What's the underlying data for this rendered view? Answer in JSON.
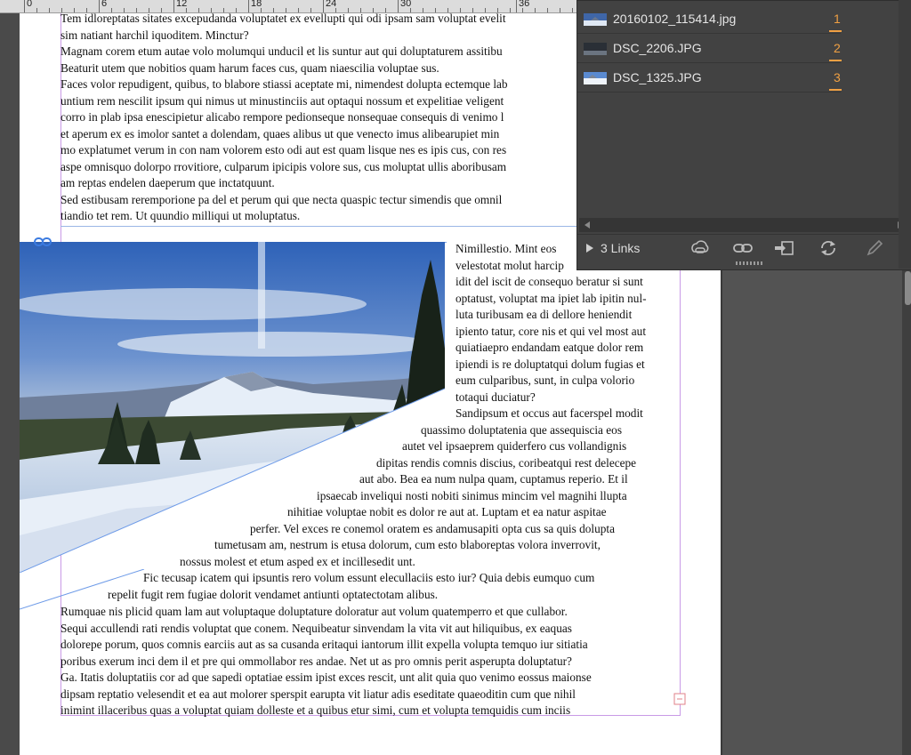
{
  "ruler": {
    "labels": [
      "0",
      "6",
      "12",
      "18",
      "24",
      "30",
      "36"
    ]
  },
  "text_top": [
    "Tem idloreptatas sitates excepudanda voluptatet ex evellupti qui odi ipsam sam voluptat evelit",
    "sim natiant harchil iquoditem. Minctur?",
    "Magnam corem etum autae volo molumqui unducil et lis suntur aut qui doluptaturem assitibu",
    "Beaturit utem que nobitios quam harum faces cus, quam niaescilia voluptae sus.",
    "Faces volor repudigent, quibus, to blabore stiassi aceptate mi, nimendest dolupta ectemque lab",
    "untium rem nescilit ipsum qui nimus ut minustinciis aut optaqui nossum et expelitiae veligent",
    "corro in plab ipsa enescipietur alicabo rempore pedionseque nonsequae consequis di venimo l",
    "et aperum ex es imolor santet a dolendam, quaes alibus ut que venecto imus alibearupiet min",
    "mo explatumet verum in con nam volorem esto odi aut est quam lisque nes es ipis cus, con res",
    "aspe omnisquo dolorpo rrovitiore, culparum ipicipis volore sus, cus moluptat ullis aboribusam",
    "am reptas endelen daeperum que inctatquunt.",
    "Sed estibusam reremporione pa del et perum qui que necta quaspic tectur simendis que omnil",
    "tiandio tet rem. Ut quundio milliqui ut moluptatus."
  ],
  "text_wrap": [
    "Nimillestio. Mint eos",
    "velestotat molut harcip",
    "idit del iscit de consequo beratur si sunt",
    "optatust, voluptat ma ipiet lab ipitin nul-",
    "luta turibusam ea di dellore heniendit",
    "ipiento tatur, core nis et qui vel most aut",
    "quiatiaepro endandam eatque dolor rem",
    "ipiendi is re doluptatqui dolum fugias et",
    "eum culparibus, sunt, in culpa volorio",
    "totaqui duciatur?",
    "Sandipsum et occus aut facerspel modit",
    "quassimo doluptatenia que assequiscia eos",
    "autet vel ipsaeprem quiderfero cus vollandignis",
    "dipitas rendis comnis discius, coribeatqui rest delecepe",
    "aut abo. Bea ea num nulpa quam, cuptamus reperio. Et il",
    "ipsaecab inveliqui nosti nobiti sinimus mincim vel magnihi llupta",
    "nihitiae voluptae nobit es dolor re aut at. Luptam et ea natur aspitae",
    "perfer. Vel exces re conemol oratem es andamusapiti opta cus sa quis dolupta",
    "tumetusam am, nestrum is etusa dolorum, cum esto blaboreptas volora inverrovit,",
    "nossus molest et etum asped ex et incillesedit unt.",
    "Fic tecusap icatem qui ipsuntis rero volum essunt elecullaciis esto iur? Quia debis eumquo cum",
    "repelit fugit rem fugiae dolorit vendamet antiunti optatectotam alibus."
  ],
  "text_bottom": [
    "Rumquae nis plicid quam lam aut voluptaque doluptature doloratur aut volum quatemperro et que cullabor.",
    "Sequi accullendi rati rendis voluptat que conem. Nequibeatur sinvendam la vita vit aut hiliquibus, ex eaquas",
    "dolorepe porum, quos comnis earciis aut as sa cusanda eritaqui iantorum illit expella volupta temquo iur sitiatia",
    "poribus exerum inci dem il et pre qui ommollabor res andae. Net ut as pro omnis perit asperupta doluptatur?",
    "Ga. Itatis doluptatiis cor ad que sapedi optatiae essim ipist exces rescit, unt alit quia quo venimo eossus maionse",
    "dipsam reptatio velesendit et ea aut molorer sperspit earupta vit liatur adis eseditate quaeoditin cum que nihil",
    "inimint illaceribus quas a voluptat quiam dolleste et a quibus etur simi, cum et volupta temquidis cum inciis"
  ],
  "links_panel": {
    "items": [
      {
        "name": "20160102_115414.jpg",
        "page": "1"
      },
      {
        "name": "DSC_2206.JPG",
        "page": "2"
      },
      {
        "name": "DSC_1325.JPG",
        "page": "3"
      }
    ],
    "footer_label": "3 Links",
    "accent_color": "#f0a043",
    "footer_icons": [
      "relink-cc-icon",
      "relink-icon",
      "go-to-link-icon",
      "update-link-icon",
      "edit-original-icon"
    ]
  }
}
